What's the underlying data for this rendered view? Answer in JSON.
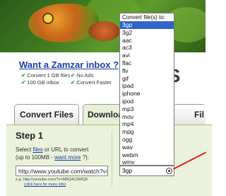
{
  "promo": {
    "title": "Want a Zamzar inbox ?",
    "features": [
      "Convert 1 GB files",
      "No Ads",
      "100 GB inbox",
      "Convert Faster"
    ]
  },
  "brand_partial": "S",
  "tabs": [
    "Convert Files",
    "Download",
    "Fil"
  ],
  "step": {
    "title": "Step 1",
    "desc_pre": "Select ",
    "files_link": "files",
    "desc_mid": " or URL to convert",
    "limit_pre": "(up to 100MB - ",
    "want_more": "want more",
    "limit_post": " ?):",
    "url_value": "http://www.youtube.com/watch?v=",
    "example": "e.g. http://youtube.com/?v=MBQ4U3RfQ8",
    "help_link": "(click here for more info)"
  },
  "dropdown": {
    "header": "Convert file(s) to:",
    "selected": "3gp",
    "options": [
      "3gp",
      "3g2",
      "aac",
      "ac3",
      "avi",
      "flac",
      "flv",
      "gif",
      "ipad",
      "iphone",
      "ipod",
      "mp3",
      "mov",
      "mp4",
      "mpg",
      "ogg",
      "wav",
      "webm",
      "wmv"
    ]
  },
  "colors": {
    "highlight": "#3165c8",
    "link": "#1a3fa8",
    "panel": "#eaf2db",
    "annotation": "#e02020"
  }
}
